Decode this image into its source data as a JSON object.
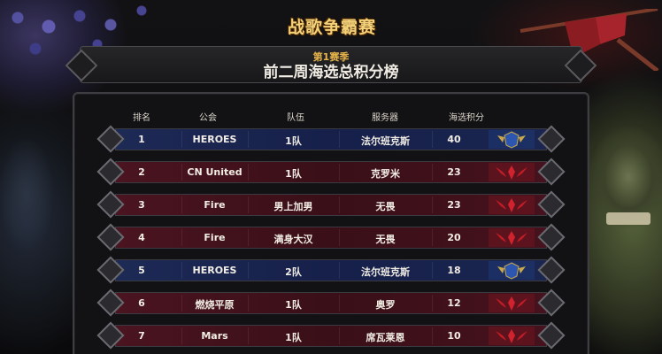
{
  "logo": {
    "text": "战歌争霸赛"
  },
  "banner": {
    "season": "第1赛季",
    "title": "前二周海选总积分榜"
  },
  "table": {
    "headers": {
      "rank": "排名",
      "guild": "公会",
      "team": "队伍",
      "server": "服务器",
      "points": "海选积分"
    },
    "rows": [
      {
        "rank": "1",
        "guild": "HEROES",
        "team": "1队",
        "server": "法尔班克斯",
        "points": "40",
        "faction": "alliance"
      },
      {
        "rank": "2",
        "guild": "CN United",
        "team": "1队",
        "server": "克罗米",
        "points": "23",
        "faction": "horde"
      },
      {
        "rank": "3",
        "guild": "Fire",
        "team": "男上加男",
        "server": "无畏",
        "points": "23",
        "faction": "horde"
      },
      {
        "rank": "4",
        "guild": "Fire",
        "team": "满身大汉",
        "server": "无畏",
        "points": "20",
        "faction": "horde"
      },
      {
        "rank": "5",
        "guild": "HEROES",
        "team": "2队",
        "server": "法尔班克斯",
        "points": "18",
        "faction": "alliance"
      },
      {
        "rank": "6",
        "guild": "燃烧平原",
        "team": "1队",
        "server": "奥罗",
        "points": "12",
        "faction": "horde"
      },
      {
        "rank": "7",
        "guild": "Mars",
        "team": "1队",
        "server": "席瓦莱恩",
        "points": "10",
        "faction": "horde"
      }
    ]
  },
  "colors": {
    "alliance": "#1d2a55",
    "horde": "#4a1420",
    "accent_gold": "#e6b44a"
  },
  "icons": {
    "alliance": "alliance-emblem-icon",
    "horde": "horde-emblem-icon"
  }
}
